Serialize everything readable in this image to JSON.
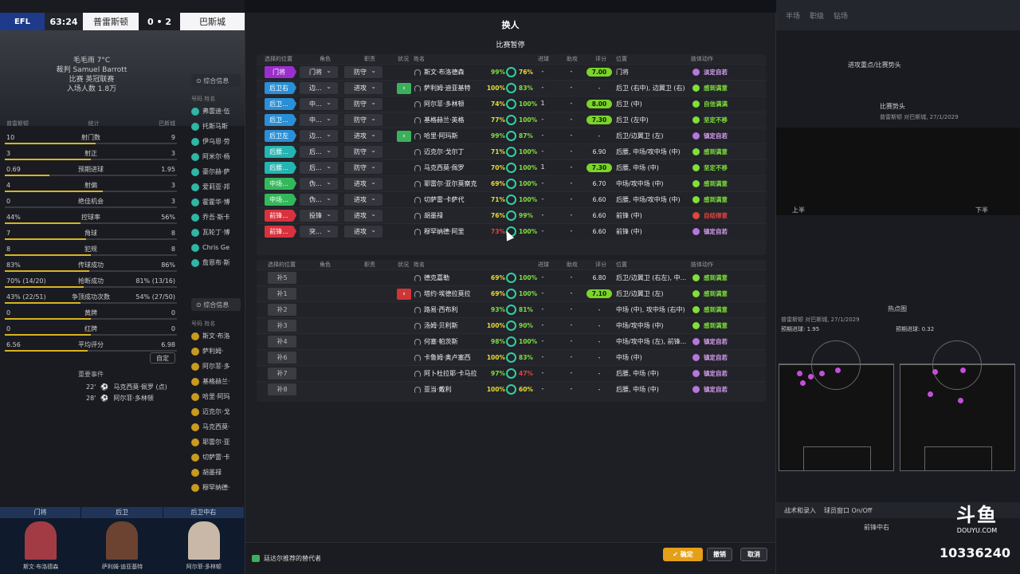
{
  "scoreboard": {
    "league": "EFL",
    "clock": "63:24",
    "home_team": "普雷斯顿",
    "score": "0 • 2",
    "away_team": "巴斯城"
  },
  "match_info": {
    "weather": "毛毛雨 7°C",
    "referee": "裁判 Samuel Barrott",
    "stadium": "比赛 英冠联赛",
    "attendance": "入场人数 1.8万"
  },
  "info_dropdowns": [
    "综合信息",
    "综合信息"
  ],
  "stats_header": {
    "left": "普雷斯顿",
    "center": "统计",
    "right": "巴斯城"
  },
  "stats": [
    {
      "left": "10",
      "label": "射门数",
      "right": "9",
      "fill": 0.53
    },
    {
      "left": "3",
      "label": "射正",
      "right": "3",
      "fill": 0.5
    },
    {
      "left": "0.69",
      "label": "预期进球",
      "right": "1.95",
      "fill": 0.26
    },
    {
      "left": "4",
      "label": "射偏",
      "right": "3",
      "fill": 0.57
    },
    {
      "left": "0",
      "label": "绝佳机会",
      "right": "3",
      "fill": 0.0
    },
    {
      "left": "44%",
      "label": "控球率",
      "right": "56%",
      "fill": 0.44
    },
    {
      "left": "7",
      "label": "角球",
      "right": "8",
      "fill": 0.47
    },
    {
      "left": "8",
      "label": "犯规",
      "right": "8",
      "fill": 0.5
    },
    {
      "left": "83%",
      "label": "传球成功",
      "right": "86%",
      "fill": 0.49
    },
    {
      "left": "70% (14/20)",
      "label": "抢断成功",
      "right": "81% (13/16)",
      "fill": 0.46
    },
    {
      "left": "43% (22/51)",
      "label": "争顶成功次数",
      "right": "54% (27/50)",
      "fill": 0.44
    },
    {
      "left": "0",
      "label": "黄牌",
      "right": "0",
      "fill": 0.5
    },
    {
      "left": "0",
      "label": "红牌",
      "right": "0",
      "fill": 0.5
    },
    {
      "left": "6.56",
      "label": "平均评分",
      "right": "6.98",
      "fill": 0.48
    }
  ],
  "custom_button": "自定",
  "events": {
    "title": "重要事件",
    "items": [
      {
        "minute": "22'",
        "text": "马克西莫·佩罗 (点)"
      },
      {
        "minute": "28'",
        "text": "阿尔菲·多林顿"
      }
    ]
  },
  "lineup_header": "号码 姓名",
  "lineup_a": [
    "弗雷迪·伍",
    "托斯马斯",
    "伊乌恩·劳",
    "阿米尔·杨",
    "豪尔赫·萨",
    "爱莉亚·邦",
    "霍霍华·博",
    "乔吾·斯卡",
    "瓦轮丁·博",
    "Chris Ge",
    "詹恩布·斯"
  ],
  "lineup_b": [
    "斯文·布洛",
    "萨利姆·",
    "阿尔菲·多",
    "基格赫兰·",
    "哈里·阿玛",
    "迈克尔·戈",
    "马克西莫·",
    "耶雷尔·亚",
    "切萨雷·卡",
    "胡墨禄",
    "穆罕纳德·"
  ],
  "pitch_strip": [
    "门将",
    "后卫",
    "后卫中右"
  ],
  "pitch_strip_names": [
    "斯文·布洛德森",
    "萨利姆·迪亚基特",
    "阿尔菲·多林顿"
  ],
  "right_panel": {
    "top_items": [
      "半场",
      "职级",
      "钻场"
    ],
    "label1": "进攻重点/比赛势头",
    "label2": "比赛势头",
    "label3": "普雷斯顿 对巴斯城, 27/1/2029",
    "label4": "上半",
    "label5": "下半",
    "label6": "热点图",
    "label7": "普雷斯顿 对巴斯城, 27/1/2029",
    "label8": "预期进球: 1.95",
    "label9": "预期进球: 0.32",
    "bottom_items": [
      "战术和录入",
      "球员窗口 On/Off"
    ],
    "bottom_item3": "前锋中右",
    "logo_text": "斗鱼",
    "logo_sub": "DOUYU.COM",
    "room_id": "10336240"
  },
  "modal": {
    "title": "换人",
    "subtitle": "比赛暂停",
    "headers": {
      "position": "选择的位置",
      "role": "角色",
      "duty": "职责",
      "status": "状况",
      "name": "姓名",
      "goals": "进球",
      "assists": "助攻",
      "rating": "评分",
      "pos": "位置",
      "body": "肢体动作"
    },
    "starters": [
      {
        "pos": "门将",
        "pos_type": "gk",
        "role": "门将",
        "duty": "防守",
        "swap": "",
        "name": "斯文·布洛德森",
        "cond": "99%",
        "cond_color": "green",
        "sharp": "76%",
        "sharp_color": "yellow",
        "goals": "-",
        "assists": "-",
        "rating": "7.00",
        "rating_badge": true,
        "position": "门将",
        "body": "淡定自若",
        "body_color": "purple"
      },
      {
        "pos": "后卫右",
        "pos_type": "df",
        "role": "边...",
        "duty": "进攻",
        "swap": "in",
        "name": "萨利姆·迪亚基特",
        "cond": "100%",
        "cond_color": "yellow",
        "sharp": "83%",
        "sharp_color": "green",
        "goals": "-",
        "assists": "-",
        "rating": "-",
        "rating_badge": false,
        "position": "后卫 (右中), 边翼卫 (右)",
        "body": "感到满意",
        "body_color": "green"
      },
      {
        "pos": "后卫...",
        "pos_type": "df",
        "role": "中...",
        "duty": "防守",
        "swap": "",
        "name": "阿尔菲·多林顿",
        "cond": "74%",
        "cond_color": "yellow",
        "sharp": "100%",
        "sharp_color": "green",
        "goals": "1",
        "assists": "-",
        "rating": "8.00",
        "rating_badge": true,
        "position": "后卫 (中)",
        "body": "自信满满",
        "body_color": "green"
      },
      {
        "pos": "后卫...",
        "pos_type": "df",
        "role": "中...",
        "duty": "防守",
        "swap": "",
        "name": "基格赫兰·英格",
        "cond": "77%",
        "cond_color": "yellow",
        "sharp": "100%",
        "sharp_color": "green",
        "goals": "-",
        "assists": "-",
        "rating": "7.30",
        "rating_badge": true,
        "position": "后卫 (左中)",
        "body": "坚定不移",
        "body_color": "green"
      },
      {
        "pos": "后卫左",
        "pos_type": "df",
        "role": "边...",
        "duty": "进攻",
        "swap": "in",
        "name": "哈里·阿玛斯",
        "cond": "99%",
        "cond_color": "green",
        "sharp": "87%",
        "sharp_color": "green",
        "goals": "-",
        "assists": "-",
        "rating": "-",
        "rating_badge": false,
        "position": "后卫/边翼卫 (左)",
        "body": "镇定自若",
        "body_color": "purple"
      },
      {
        "pos": "后腰...",
        "pos_type": "dm",
        "role": "后...",
        "duty": "防守",
        "swap": "",
        "name": "迈克尔·戈尔丁",
        "cond": "71%",
        "cond_color": "yellow",
        "sharp": "100%",
        "sharp_color": "green",
        "goals": "-",
        "assists": "-",
        "rating": "6.90",
        "rating_badge": false,
        "position": "后腰, 中场/攻中场 (中)",
        "body": "感到满意",
        "body_color": "green"
      },
      {
        "pos": "后腰...",
        "pos_type": "dm",
        "role": "后...",
        "duty": "防守",
        "swap": "",
        "name": "马克西莫·佩罗",
        "cond": "70%",
        "cond_color": "yellow",
        "sharp": "100%",
        "sharp_color": "green",
        "goals": "1",
        "assists": "-",
        "rating": "7.30",
        "rating_badge": true,
        "position": "后腰, 中场 (中)",
        "body": "坚定不移",
        "body_color": "green"
      },
      {
        "pos": "中场...",
        "pos_type": "mf",
        "role": "伪...",
        "duty": "进攻",
        "swap": "",
        "name": "耶雷尔·亚尔莫察克",
        "cond": "69%",
        "cond_color": "yellow",
        "sharp": "100%",
        "sharp_color": "green",
        "goals": "-",
        "assists": "-",
        "rating": "6.70",
        "rating_badge": false,
        "position": "中场/攻中场 (中)",
        "body": "感到满意",
        "body_color": "green"
      },
      {
        "pos": "中场...",
        "pos_type": "mf",
        "role": "伪...",
        "duty": "进攻",
        "swap": "",
        "name": "切萨雷·卡萨代",
        "cond": "71%",
        "cond_color": "yellow",
        "sharp": "100%",
        "sharp_color": "green",
        "goals": "-",
        "assists": "-",
        "rating": "6.60",
        "rating_badge": false,
        "position": "后腰, 中场/攻中场 (中)",
        "body": "感到满意",
        "body_color": "green"
      },
      {
        "pos": "前锋...",
        "pos_type": "fw",
        "role": "投锋",
        "duty": "进攻",
        "swap": "",
        "name": "胡墨禄",
        "cond": "76%",
        "cond_color": "yellow",
        "sharp": "99%",
        "sharp_color": "green",
        "goals": "-",
        "assists": "-",
        "rating": "6.60",
        "rating_badge": false,
        "position": "前锋 (中)",
        "body": "自结得意",
        "body_color": "red"
      },
      {
        "pos": "前锋...",
        "pos_type": "fw",
        "role": "突...",
        "duty": "进攻",
        "swap": "",
        "name": "穆罕纳德·阿里",
        "cond": "73%",
        "cond_color": "red",
        "sharp": "100%",
        "sharp_color": "green",
        "goals": "-",
        "assists": "-",
        "rating": "6.60",
        "rating_badge": false,
        "position": "前锋 (中)",
        "body": "镇定自若",
        "body_color": "purple"
      }
    ],
    "subs": [
      {
        "pos": "补5",
        "swap": "",
        "name": "德克嘉勒",
        "cond": "69%",
        "cond_color": "yellow",
        "sharp": "100%",
        "sharp_color": "green",
        "goals": "-",
        "assists": "-",
        "rating": "6.80",
        "rating_badge": false,
        "position": "后卫/边翼卫 (右左), 中...",
        "body": "感到满意",
        "body_color": "green"
      },
      {
        "pos": "补1",
        "swap": "out",
        "name": "塔约·埃德拉莫拉",
        "cond": "69%",
        "cond_color": "yellow",
        "sharp": "100%",
        "sharp_color": "green",
        "goals": "-",
        "assists": "-",
        "rating": "7.10",
        "rating_badge": true,
        "position": "后卫/边翼卫 (左)",
        "body": "感到满意",
        "body_color": "green"
      },
      {
        "pos": "补2",
        "swap": "",
        "name": "路易·西布利",
        "cond": "93%",
        "cond_color": "green",
        "sharp": "81%",
        "sharp_color": "green",
        "goals": "-",
        "assists": "-",
        "rating": "-",
        "rating_badge": false,
        "position": "中场 (中), 攻中场 (右中)",
        "body": "感到满意",
        "body_color": "green"
      },
      {
        "pos": "补3",
        "swap": "",
        "name": "汤姆·贝利斯",
        "cond": "100%",
        "cond_color": "yellow",
        "sharp": "90%",
        "sharp_color": "green",
        "goals": "-",
        "assists": "-",
        "rating": "-",
        "rating_badge": false,
        "position": "中场/攻中场 (中)",
        "body": "感到满意",
        "body_color": "green"
      },
      {
        "pos": "补4",
        "swap": "",
        "name": "何塞·帕茨斯",
        "cond": "98%",
        "cond_color": "green",
        "sharp": "100%",
        "sharp_color": "green",
        "goals": "-",
        "assists": "-",
        "rating": "-",
        "rating_badge": false,
        "position": "中场/攻中场 (左), 前锋...",
        "body": "镇定自若",
        "body_color": "purple"
      },
      {
        "pos": "补6",
        "swap": "",
        "name": "卡鲁姆·奥卢塞西",
        "cond": "100%",
        "cond_color": "yellow",
        "sharp": "83%",
        "sharp_color": "green",
        "goals": "-",
        "assists": "-",
        "rating": "-",
        "rating_badge": false,
        "position": "中场 (中)",
        "body": "镇定自若",
        "body_color": "purple"
      },
      {
        "pos": "补7",
        "swap": "",
        "name": "阿卜杜拉耶·卡马拉",
        "cond": "97%",
        "cond_color": "green",
        "sharp": "47%",
        "sharp_color": "red",
        "goals": "-",
        "assists": "-",
        "rating": "-",
        "rating_badge": false,
        "position": "后腰, 中场 (中)",
        "body": "镇定自若",
        "body_color": "purple"
      },
      {
        "pos": "补8",
        "swap": "",
        "name": "亚当·戴利",
        "cond": "100%",
        "cond_color": "yellow",
        "sharp": "60%",
        "sharp_color": "yellow",
        "goals": "-",
        "assists": "-",
        "rating": "-",
        "rating_badge": false,
        "position": "后腰, 中场 (中)",
        "body": "镇定自若",
        "body_color": "purple"
      }
    ],
    "footer": {
      "hint": "廷达尔推荐的替代者",
      "confirm": "确定",
      "undo": "撤销",
      "cancel": "取消"
    }
  },
  "colors": {
    "accent": "#e5a019",
    "gk": "#9b2fcd",
    "df": "#2a8fd6",
    "dm": "#24b5b0",
    "mf": "#33b95b",
    "fw": "#d8323e"
  }
}
